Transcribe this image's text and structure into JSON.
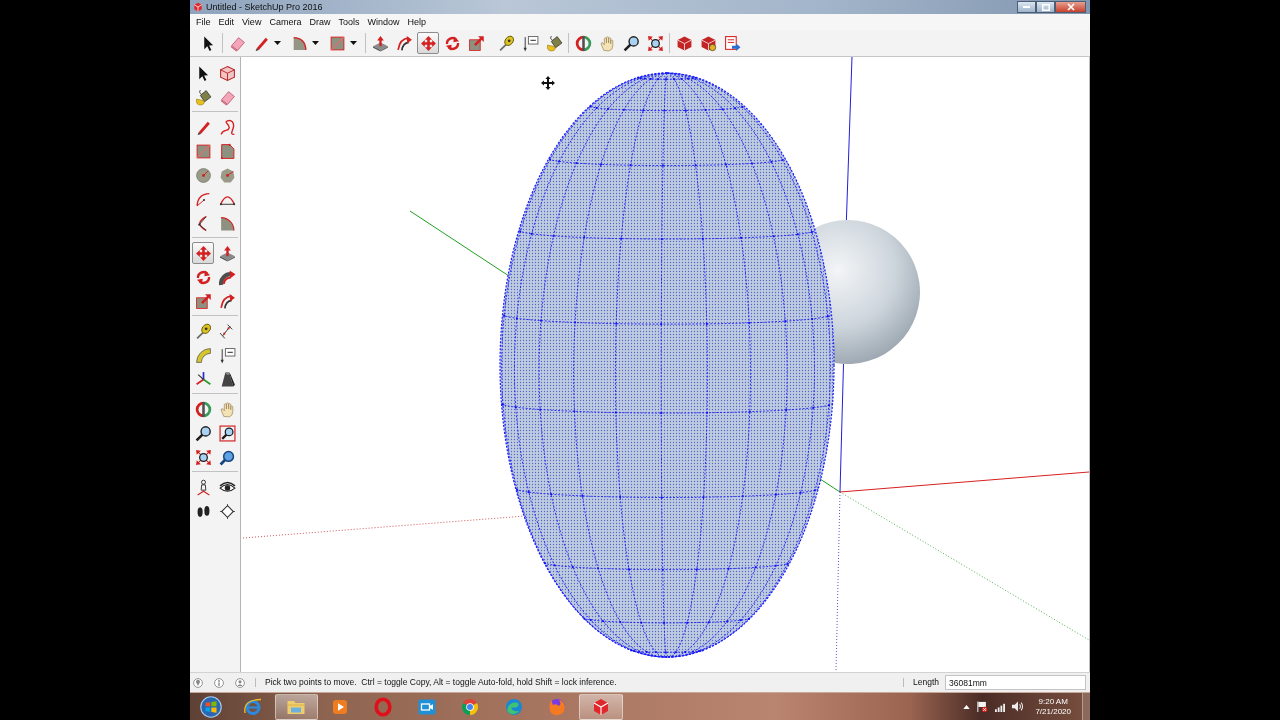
{
  "window": {
    "title": "Untitled - SketchUp Pro 2016"
  },
  "menu_bar": [
    {
      "label": "File"
    },
    {
      "label": "Edit"
    },
    {
      "label": "View"
    },
    {
      "label": "Camera"
    },
    {
      "label": "Draw"
    },
    {
      "label": "Tools"
    },
    {
      "label": "Window"
    },
    {
      "label": "Help"
    }
  ],
  "toolbar": {
    "groups": [
      [
        {
          "selected": false
        }
      ],
      [
        {
          "selected": false
        },
        {
          "selected": false
        },
        {
          "selected": false
        },
        {
          "selected": false
        }
      ],
      [
        {
          "selected": false
        },
        {
          "selected": false
        },
        {
          "selected": true
        },
        {
          "selected": false
        },
        {
          "selected": false
        }
      ],
      [
        {
          "selected": false
        },
        {
          "selected": false
        },
        {
          "selected": false
        }
      ],
      [
        {
          "selected": false
        },
        {
          "selected": false
        },
        {
          "selected": false
        },
        {
          "selected": false
        }
      ],
      [
        {
          "selected": false
        },
        {
          "selected": false
        },
        {
          "selected": false
        }
      ]
    ]
  },
  "tool_palette": {
    "groups": [
      [
        {
          "selected": false
        },
        {
          "selected": false
        },
        {
          "selected": false
        },
        {
          "selected": false
        }
      ],
      [
        {
          "selected": false
        },
        {
          "selected": false
        },
        {
          "selected": false
        },
        {
          "selected": false
        },
        {
          "selected": false
        },
        {
          "selected": false
        },
        {
          "selected": false
        },
        {
          "selected": false
        },
        {
          "selected": false
        },
        {
          "selected": false
        }
      ],
      [
        {
          "selected": true
        },
        {
          "selected": false
        },
        {
          "selected": false
        },
        {
          "selected": false
        },
        {
          "selected": false
        },
        {
          "selected": false
        }
      ],
      [
        {
          "selected": false
        },
        {
          "selected": false
        },
        {
          "selected": false
        },
        {
          "selected": false
        },
        {
          "selected": false
        },
        {
          "selected": false
        }
      ],
      [
        {
          "selected": false
        },
        {
          "selected": false
        },
        {
          "selected": false
        },
        {
          "selected": false
        },
        {
          "selected": false
        },
        {
          "selected": false
        }
      ],
      [
        {
          "selected": false
        },
        {
          "selected": false
        },
        {
          "selected": false
        },
        {
          "selected": false
        }
      ]
    ]
  },
  "status_bar": {
    "message": "Pick two points to move.  Ctrl = toggle Copy, Alt = toggle Auto-fold, hold Shift = lock inference.",
    "measurement_label": "Length",
    "measurement_value": "36081mm"
  },
  "taskbar": {
    "apps": [
      {
        "open": false
      },
      {
        "open": true
      },
      {
        "open": false
      },
      {
        "open": false
      },
      {
        "open": false
      },
      {
        "open": false
      },
      {
        "open": false
      },
      {
        "open": false
      },
      {
        "open": true
      }
    ],
    "clock": {
      "time": "9:20 AM",
      "date": "7/21/2020"
    }
  }
}
